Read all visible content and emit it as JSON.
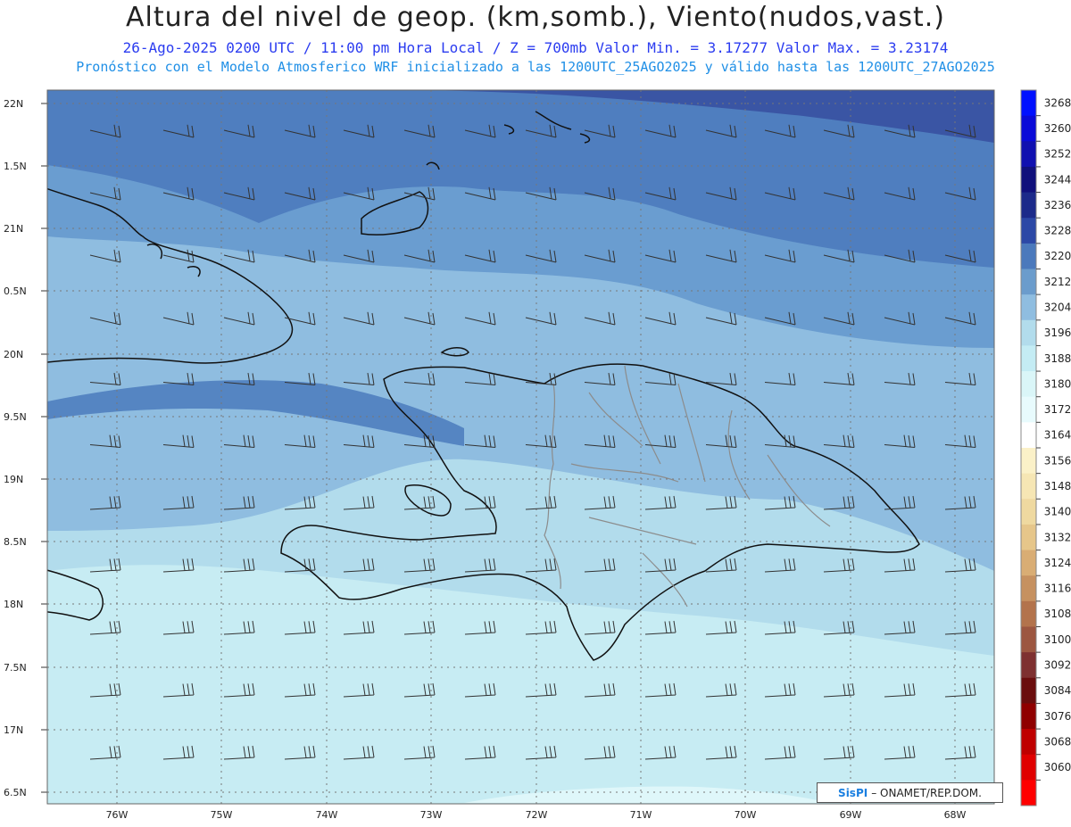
{
  "title": "Altura del nivel de geop. (km,somb.), Viento(nudos,vast.)",
  "subtitle": "26-Ago-2025  0200 UTC / 11:00 pm Hora Local / Z = 700mb    Valor Min. = 3.17277  Valor Max. = 3.23174",
  "subtitle2": "Pronóstico con el Modelo Atmosferico WRF inicializado a las 1200UTC_25AGO2025 y válido hasta las  1200UTC_27AGO2025",
  "lat_labels": [
    "22N",
    "1.5N",
    "21N",
    "0.5N",
    "20N",
    "9.5N",
    "19N",
    "8.5N",
    "18N",
    "7.5N",
    "17N",
    "6.5N"
  ],
  "lon_labels": [
    "76W",
    "75W",
    "74W",
    "73W",
    "72W",
    "71W",
    "70W",
    "69W",
    "68W"
  ],
  "colorbar": {
    "levels": [
      "3268",
      "3260",
      "3252",
      "3244",
      "3236",
      "3228",
      "3220",
      "3212",
      "3204",
      "3196",
      "3188",
      "3180",
      "3172",
      "3164",
      "3156",
      "3148",
      "3140",
      "3132",
      "3124",
      "3116",
      "3108",
      "3100",
      "3092",
      "3084",
      "3076",
      "3068",
      "3060"
    ],
    "colors": [
      "#0010ff",
      "#0a0ad8",
      "#1010b0",
      "#10107c",
      "#1c2a8a",
      "#2c48a6",
      "#4b79bc",
      "#6b9ccc",
      "#8fbde0",
      "#b2dcec",
      "#c4ecf4",
      "#daf6f8",
      "#e8fbfd",
      "#ffffff",
      "#fbf1c8",
      "#f6e6b4",
      "#efd9a0",
      "#e6c68a",
      "#d9ad74",
      "#c69160",
      "#b3734c",
      "#9c5640",
      "#7e3030",
      "#6a0d0d",
      "#8f0000",
      "#bf0000",
      "#e00000",
      "#ff0000"
    ]
  },
  "credit": {
    "brand": "SisPI",
    "text": "– ONAMET/REP.DOM."
  },
  "colors": {
    "deep": "#3a55a4",
    "mid1": "#4f7ebf",
    "mid2": "#6a9dd0",
    "mid3": "#8fbde0",
    "light1": "#b2dcec",
    "light2": "#c7ecf3"
  }
}
